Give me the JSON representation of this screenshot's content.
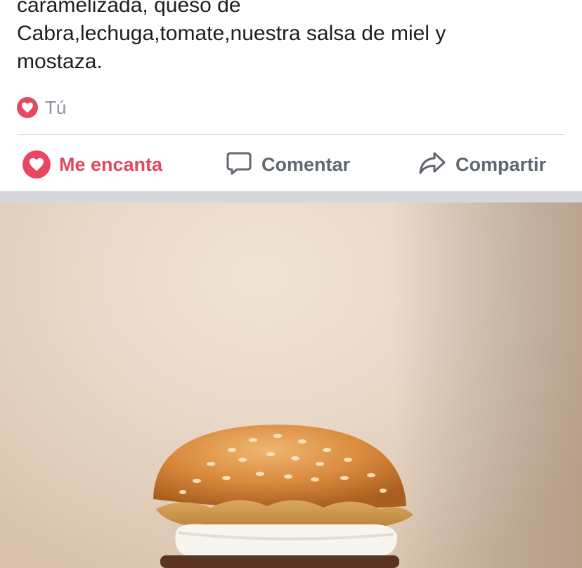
{
  "post": {
    "text_lines": [
      "caramelizada, queso de",
      "Cabra,lechuga,tomate,nuestra salsa de miel y",
      "mostaza."
    ],
    "reactions_text": "Tú"
  },
  "actions": {
    "love_label": "Me encanta",
    "comment_label": "Comentar",
    "share_label": "Compartir"
  },
  "colors": {
    "love_red": "#e8475f",
    "action_gray": "#606770",
    "divider": "#dadde1",
    "feed_gap": "#d6d7dc"
  },
  "icons": [
    "heart-icon",
    "comment-icon",
    "share-icon"
  ]
}
